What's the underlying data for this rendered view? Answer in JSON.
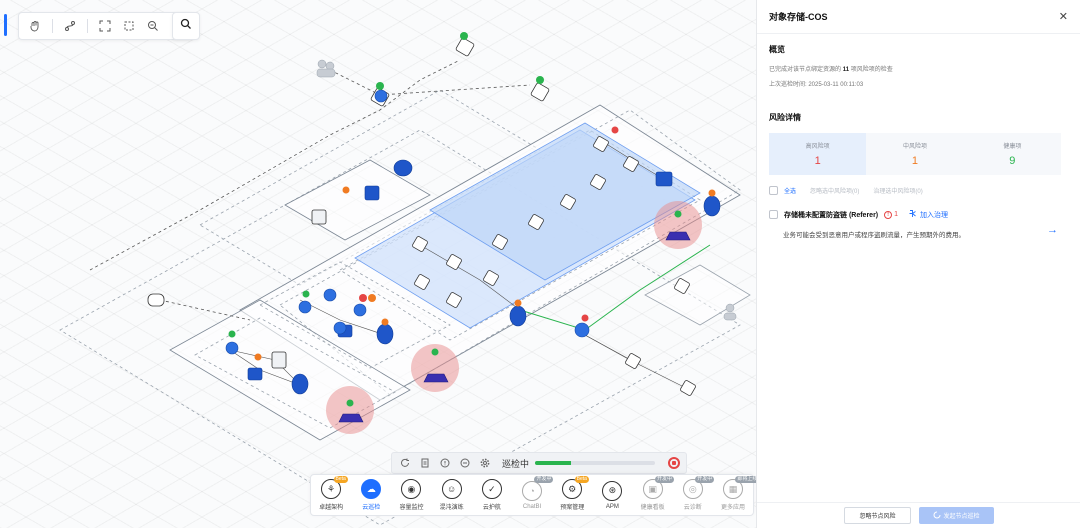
{
  "canvas": {
    "toolbar": {
      "icons": [
        "hand-icon",
        "route-icon",
        "fit-screen-icon",
        "fullscreen-icon",
        "zoom-out-icon",
        "zoom-in-icon"
      ]
    },
    "search_icon": "search-icon",
    "inspection": {
      "status": "巡检中",
      "progress": 0.3
    },
    "dock": [
      {
        "label": "卓越架构",
        "badge": "Beta",
        "icon": "architecture-icon"
      },
      {
        "label": "云巡检",
        "badge": "",
        "icon": "cloud-inspection-icon",
        "active": true
      },
      {
        "label": "容量监控",
        "badge": "",
        "icon": "capacity-monitor-icon"
      },
      {
        "label": "混沌演练",
        "badge": "",
        "icon": "chaos-drill-icon"
      },
      {
        "label": "云护航",
        "badge": "",
        "icon": "cloud-escort-icon"
      },
      {
        "label": "ChatBI",
        "badge": "开发中",
        "icon": "chatbi-icon",
        "dim": true
      },
      {
        "label": "预案管理",
        "badge": "Beta",
        "icon": "plan-management-icon"
      },
      {
        "label": "APM",
        "badge": "",
        "icon": "apm-icon"
      },
      {
        "label": "健康看板",
        "badge": "开发中",
        "icon": "health-board-icon",
        "dim": true
      },
      {
        "label": "云诊断",
        "badge": "开发中",
        "icon": "cloud-diagnosis-icon",
        "dim": true
      },
      {
        "label": "更多应用",
        "badge": "即将上线",
        "icon": "more-apps-icon",
        "dim": true
      }
    ],
    "colors": {
      "accent": "#1f6fff",
      "danger": "#e54545",
      "warning": "#f07b22",
      "healthy": "#2ab44e"
    }
  },
  "panel": {
    "title": "对象存储-COS",
    "overview": {
      "heading": "概览",
      "summary_prefix": "已完成对该节点绑定资源的",
      "summary_count": "11",
      "summary_suffix": "项风险项的检查",
      "last_check": "上次巡检时间: 2025-03-11 00:11:03"
    },
    "details": {
      "heading": "风险详情",
      "stats": [
        {
          "label": "高风险项",
          "value": "1",
          "color": "#e54545"
        },
        {
          "label": "中风险项",
          "value": "1",
          "color": "#f07b22"
        },
        {
          "label": "健康项",
          "value": "9",
          "color": "#2ab44e"
        }
      ],
      "filters": {
        "all": "全选",
        "ignore": "忽略选中风险项(0)",
        "govern": "治理选中风险项(0)"
      },
      "risk_item": {
        "title": "存储桶未配置防盗链 (Referer)",
        "count": "1",
        "action": "加入治理",
        "description": "业务可能会受到恶意用户或程序盗刷流量，产生预期外的费用。"
      }
    },
    "footer": {
      "ignore_btn": "忽略节点风险",
      "inspect_btn": "发起节点巡检"
    }
  }
}
